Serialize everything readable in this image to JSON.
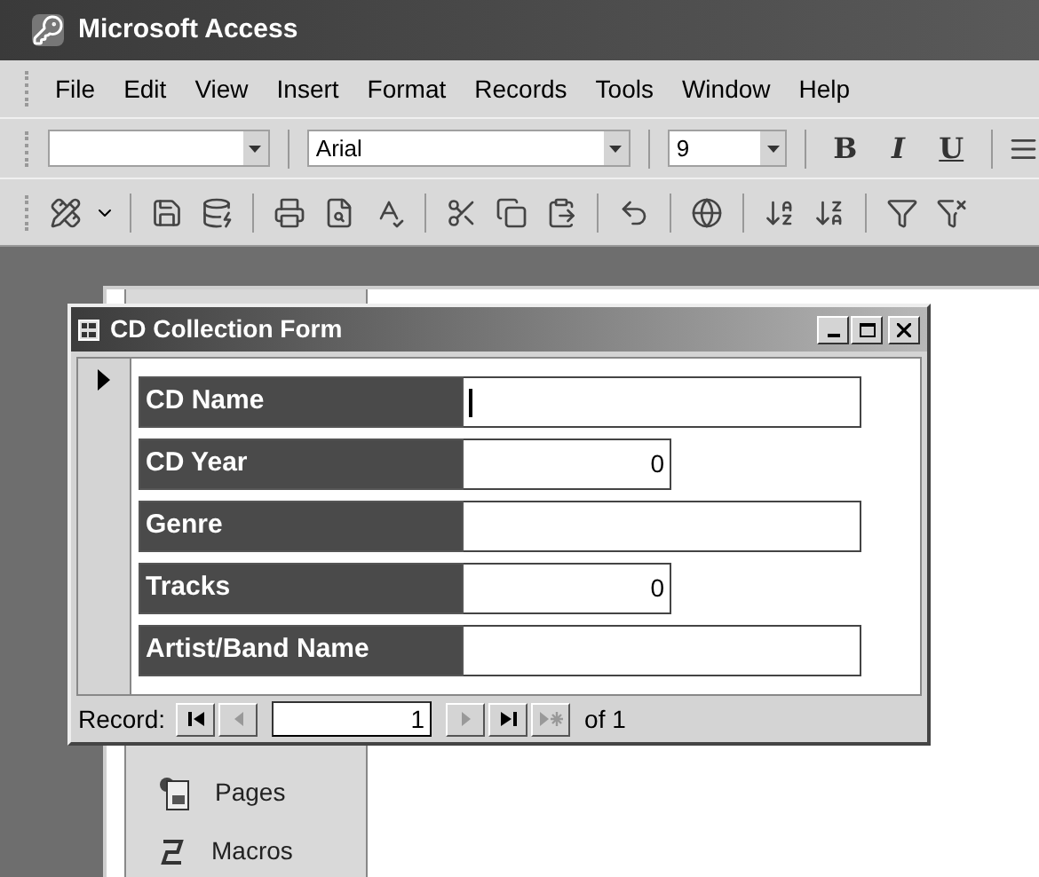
{
  "app_title": "Microsoft Access",
  "menu": [
    {
      "label": "File"
    },
    {
      "label": "Edit"
    },
    {
      "label": "View"
    },
    {
      "label": "Insert"
    },
    {
      "label": "Format"
    },
    {
      "label": "Records"
    },
    {
      "label": "Tools"
    },
    {
      "label": "Window"
    },
    {
      "label": "Help"
    }
  ],
  "format_toolbar": {
    "font_combo": {
      "value": "Arial"
    },
    "size_combo": {
      "value": "9"
    },
    "style_buttons": [
      {
        "label": "B",
        "kind": "bold"
      },
      {
        "label": "I",
        "kind": "italic"
      },
      {
        "label": "U",
        "kind": "underline"
      }
    ]
  },
  "database_window": {
    "items": [
      {
        "label": "Pages",
        "kind": "pages"
      },
      {
        "label": "Macros",
        "kind": "macros"
      }
    ]
  },
  "form_window": {
    "title": "CD Collection Form",
    "fields": [
      {
        "label": "CD Name",
        "kind": "text",
        "focused": true
      },
      {
        "label": "CD Year",
        "value": "0",
        "kind": "number",
        "focused": false
      },
      {
        "label": "Genre",
        "kind": "text",
        "focused": false
      },
      {
        "label": "Tracks",
        "value": "0",
        "kind": "number",
        "focused": false
      },
      {
        "label": "Artist/Band Name",
        "kind": "text",
        "focused": false
      }
    ],
    "navigation": {
      "label": "Record:",
      "current": "1",
      "total": "of 1"
    }
  }
}
